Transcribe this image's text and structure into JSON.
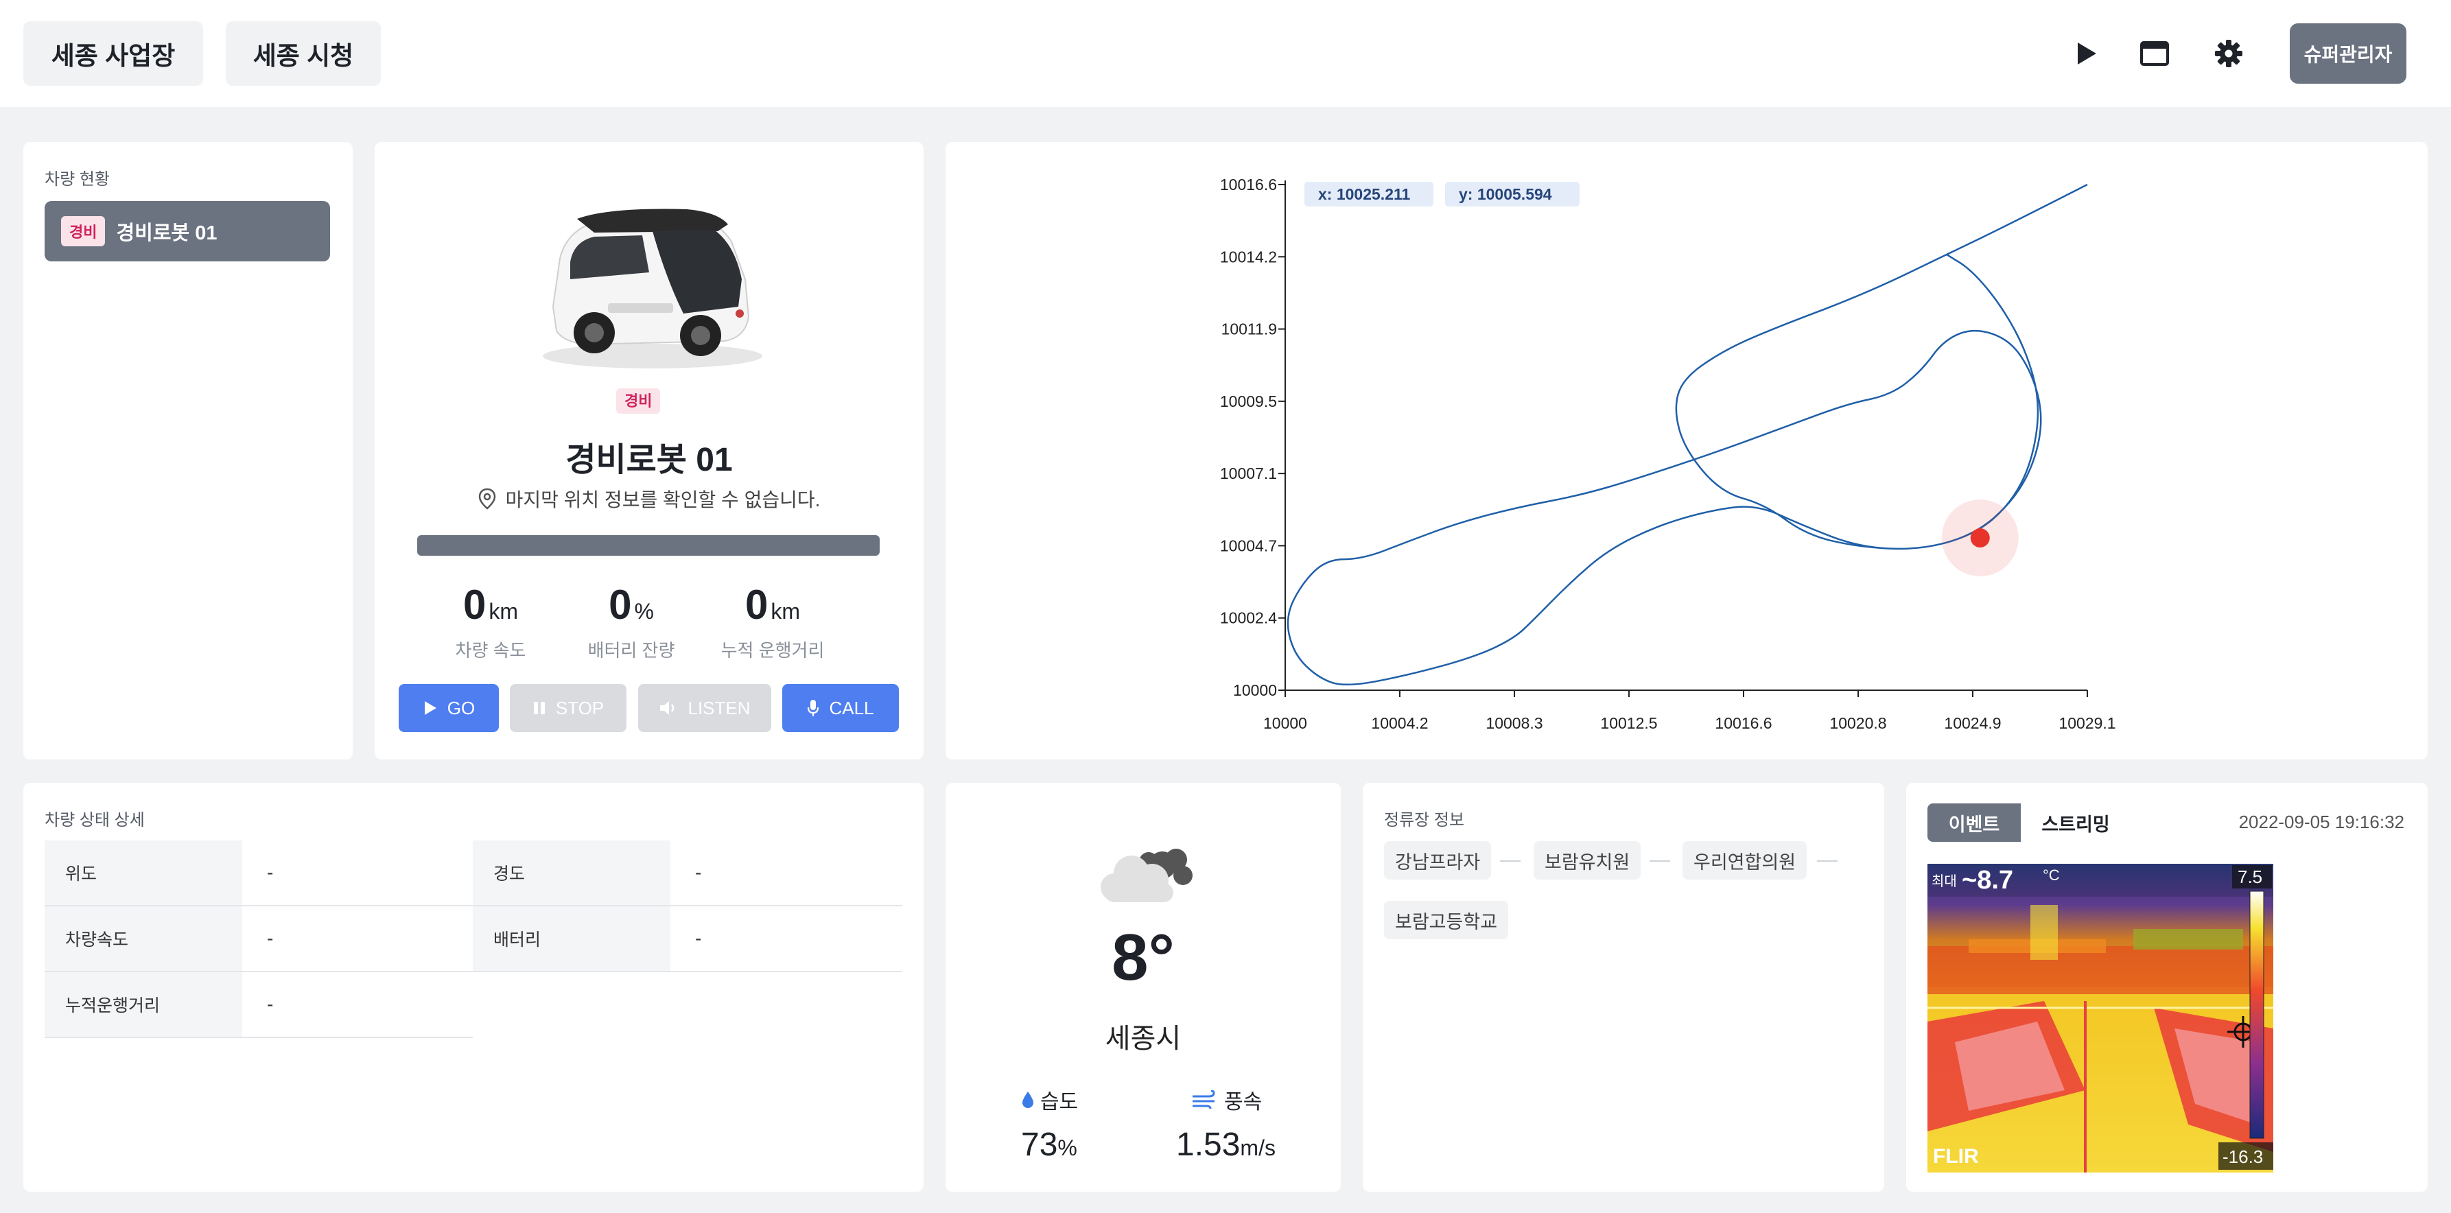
{
  "header": {
    "sites": [
      "세종 사업장",
      "세종 시청"
    ],
    "icons": [
      "play-icon",
      "window-icon",
      "gear-icon"
    ],
    "admin_label": "슈퍼관리자"
  },
  "vehicle_list": {
    "title": "차량 현황",
    "items": [
      {
        "badge": "경비",
        "name": "경비로봇 01"
      }
    ]
  },
  "vehicle_detail": {
    "badge": "경비",
    "name": "경비로봇 01",
    "location": "마지막 위치 정보를 확인할 수 없습니다.",
    "stats": [
      {
        "value": "0",
        "unit": "km",
        "label": "차량 속도"
      },
      {
        "value": "0",
        "unit": "%",
        "label": "배터리 잔량"
      },
      {
        "value": "0",
        "unit": "km",
        "label": "누적 운행거리"
      }
    ],
    "controls": {
      "go": "GO",
      "stop": "STOP",
      "listen": "LISTEN",
      "call": "CALL"
    }
  },
  "chart_data": {
    "type": "line",
    "title": "",
    "xlabel": "",
    "ylabel": "",
    "xlim": [
      10000,
      10029.1
    ],
    "ylim": [
      10000,
      10016.6
    ],
    "x_ticks": [
      "10000",
      "10004.2",
      "10008.3",
      "10012.5",
      "10016.6",
      "10020.8",
      "10024.9",
      "10029.1"
    ],
    "y_ticks": [
      "10000",
      "10002.4",
      "10004.7",
      "10007.1",
      "10009.5",
      "10011.9",
      "10014.2",
      "10016.6"
    ],
    "cursor_x_label": "x: 10025.211",
    "cursor_y_label": "y: 10005.594",
    "grid": false,
    "series": [
      {
        "points": [
          [
            10029.1,
            10016.6
          ],
          [
            10026.5,
            10015.4
          ],
          [
            10024.0,
            10014.3
          ],
          [
            10021.0,
            10013.0
          ],
          [
            10017.5,
            10011.8
          ],
          [
            10015.8,
            10011.1
          ],
          [
            10014.4,
            10010.2
          ],
          [
            10014.1,
            10009.2
          ],
          [
            10014.5,
            10007.9
          ],
          [
            10015.8,
            10006.5
          ],
          [
            10017.4,
            10006.1
          ],
          [
            10018.9,
            10005.1
          ],
          [
            10020.8,
            10004.7
          ],
          [
            10023.0,
            10004.6
          ],
          [
            10025.0,
            10005.1
          ],
          [
            10026.4,
            10006.2
          ],
          [
            10027.2,
            10007.5
          ],
          [
            10027.5,
            10009.0
          ],
          [
            10027.1,
            10010.4
          ],
          [
            10026.3,
            10011.5
          ],
          [
            10025.0,
            10011.9
          ],
          [
            10023.9,
            10011.5
          ],
          [
            10023.1,
            10010.5
          ],
          [
            10022.0,
            10009.7
          ],
          [
            10020.4,
            10009.4
          ],
          [
            10018.3,
            10008.7
          ],
          [
            10015.6,
            10007.8
          ],
          [
            10012.6,
            10006.9
          ],
          [
            10010.7,
            10006.4
          ],
          [
            10008.4,
            10006.0
          ],
          [
            10006.3,
            10005.5
          ],
          [
            10004.5,
            10004.9
          ],
          [
            10002.8,
            10004.3
          ],
          [
            10001.5,
            10004.3
          ],
          [
            10000.6,
            10003.5
          ],
          [
            10000.0,
            10002.4
          ],
          [
            10000.3,
            10001.2
          ],
          [
            10001.2,
            10000.4
          ],
          [
            10002.2,
            10000.1
          ],
          [
            10004.5,
            10000.5
          ],
          [
            10006.9,
            10001.1
          ],
          [
            10008.3,
            10001.7
          ],
          [
            10009.0,
            10002.3
          ],
          [
            10010.3,
            10003.5
          ],
          [
            10011.7,
            10004.6
          ],
          [
            10013.5,
            10005.4
          ],
          [
            10015.4,
            10005.9
          ],
          [
            10017.1,
            10006.1
          ],
          [
            10018.8,
            10005.4
          ],
          [
            10020.8,
            10004.7
          ],
          [
            10023.0,
            10004.6
          ],
          [
            10025.0,
            10005.1
          ],
          [
            10026.3,
            10006.1
          ],
          [
            10027.1,
            10007.5
          ],
          [
            10027.4,
            10009.4
          ],
          [
            10026.9,
            10011.1
          ],
          [
            10026.0,
            10012.6
          ],
          [
            10024.9,
            10013.8
          ],
          [
            10024.0,
            10014.3
          ]
        ]
      }
    ],
    "marker": {
      "x": 10025.211,
      "y": 10005.0,
      "color": "#e8332b"
    }
  },
  "vehicle_status": {
    "title": "차량 상태 상세",
    "rows": [
      [
        {
          "k": "위도",
          "v": "-"
        },
        {
          "k": "경도",
          "v": "-"
        }
      ],
      [
        {
          "k": "차량속도",
          "v": "-"
        },
        {
          "k": "배터리",
          "v": "-"
        }
      ],
      [
        {
          "k": "누적운행거리",
          "v": "-"
        }
      ]
    ]
  },
  "weather": {
    "icon": "cloudy-icon",
    "temp": "8°",
    "city": "세종시",
    "humidity_label": "습도",
    "humidity_value": "73",
    "humidity_unit": "%",
    "wind_label": "풍속",
    "wind_value": "1.53",
    "wind_unit": "m/s"
  },
  "stops": {
    "title": "정류장 정보",
    "items": [
      "강남프라자",
      "보람유치원",
      "우리연합의원",
      "보람고등학교"
    ]
  },
  "camera": {
    "tabs": [
      "이벤트",
      "스트리밍"
    ],
    "timestamp": "2022-09-05 19:16:32",
    "max_label": "최대",
    "temp_readout": "~8.7",
    "temp_unit": "°C",
    "scale_max": "7.5",
    "scale_min": "-16.3",
    "brand": "FLIR"
  }
}
